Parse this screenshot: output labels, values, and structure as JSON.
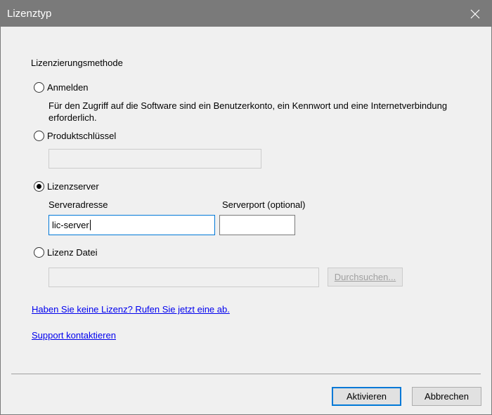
{
  "window": {
    "title": "Lizenztyp"
  },
  "licensing": {
    "heading": "Lizenzierungsmethode",
    "sign_in": {
      "label": "Anmelden",
      "description": "Für den Zugriff auf die Software sind ein Benutzerkonto, ein Kennwort und eine Internetverbindung erforderlich.",
      "selected": false
    },
    "product_key": {
      "label": "Produktschlüssel",
      "value": "",
      "selected": false
    },
    "license_server": {
      "label": "Lizenzserver",
      "selected": true,
      "server_address_label": "Serveradresse",
      "server_address_value": "lic-server",
      "server_port_label": "Serverport (optional)",
      "server_port_value": ""
    },
    "license_file": {
      "label": "Lizenz Datei",
      "value": "",
      "selected": false,
      "browse_label": "Durchsuchen..."
    }
  },
  "links": {
    "get_license": "Haben Sie keine Lizenz? Rufen Sie jetzt eine ab.",
    "support": "Support kontaktieren"
  },
  "buttons": {
    "activate": "Aktivieren",
    "cancel": "Abbrechen"
  }
}
